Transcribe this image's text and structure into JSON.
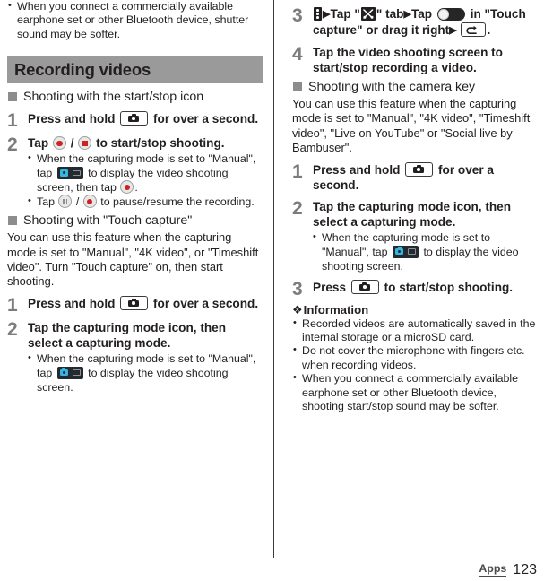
{
  "page": {
    "footer_tab": "Apps",
    "page_number": "123"
  },
  "left_column": {
    "intro_notes": [
      "When you connect a commercially available earphone set or other Bluetooth device, shutter sound may be softer."
    ],
    "section_title": "Recording videos",
    "subsection_1": {
      "heading": "Shooting with the start/stop icon",
      "steps": [
        {
          "number": "1",
          "title_before_icon": "Press and hold",
          "title_after_icon": "for over a second.",
          "icon": "camera-key-icon"
        },
        {
          "number": "2",
          "title_part_1": "Tap",
          "title_part_2": "/",
          "title_part_3": "to start/stop shooting.",
          "icon_1": "record-button-icon",
          "icon_2": "stop-button-icon",
          "notes": [
            {
              "text_1": "When the capturing mode is set to \"Manual\", tap",
              "icon": "photo-video-mode-switch-icon",
              "text_2": "to display the video shooting screen, then tap",
              "icon_2": "record-button-icon",
              "text_3": "."
            },
            {
              "text_1": "Tap",
              "icon": "pause-button-icon",
              "text_2": "/",
              "icon_2": "record-button-icon",
              "text_3": "to pause/resume the recording."
            }
          ]
        }
      ]
    },
    "subsection_2": {
      "heading": "Shooting with \"Touch capture\"",
      "paragraph": "You can use this feature when the capturing mode is set to \"Manual\", \"4K video\", or \"Timeshift video\". Turn \"Touch capture\" on, then start shooting.",
      "steps": [
        {
          "number": "1",
          "title_before_icon": "Press and hold",
          "title_after_icon": "for over a second.",
          "icon": "camera-key-icon"
        },
        {
          "number": "2",
          "title": "Tap the capturing mode icon, then select a capturing mode.",
          "notes": [
            {
              "text_1": "When the capturing mode is set to \"Manual\", tap",
              "icon": "photo-video-mode-switch-icon",
              "text_2": "to display the video shooting screen."
            }
          ]
        }
      ]
    }
  },
  "right_column": {
    "steps_continued": [
      {
        "number": "3",
        "icon_1": "overflow-menu-icon",
        "arrow_1": "▶",
        "text_1": "Tap \"",
        "icon_2": "tools-tab-icon",
        "text_2": "\" tab",
        "arrow_2": "▶",
        "text_3": "Tap",
        "icon_3": "toggle-switch-icon",
        "text_4": "in \"Touch capture\" or drag it right",
        "arrow_3": "▶",
        "icon_4": "back-key-icon",
        "text_5": "."
      },
      {
        "number": "4",
        "title": "Tap the video shooting screen to start/stop recording a video."
      }
    ],
    "subsection_3": {
      "heading": "Shooting with the camera key",
      "paragraph": "You can use this feature when the capturing mode is set to \"Manual\", \"4K video\", \"Timeshift video\", \"Live on YouTube\" or \"Social live by Bambuser\".",
      "steps": [
        {
          "number": "1",
          "title_before_icon": "Press and hold",
          "title_after_icon": "for over a second.",
          "icon": "camera-key-icon"
        },
        {
          "number": "2",
          "title": "Tap the capturing mode icon, then select a capturing mode.",
          "notes": [
            {
              "text_1": "When the capturing mode is set to \"Manual\", tap",
              "icon": "photo-video-mode-switch-icon",
              "text_2": "to display the video shooting screen."
            }
          ]
        },
        {
          "number": "3",
          "title_before_icon": "Press",
          "title_after_icon": "to start/stop shooting.",
          "icon": "camera-key-icon"
        }
      ]
    },
    "information": {
      "heading": "Information",
      "diamond": "❖",
      "notes": [
        "Recorded videos are automatically saved in the internal storage or a microSD card.",
        "Do not cover the microphone with fingers etc. when recording videos.",
        "When you connect a commercially available earphone set or other Bluetooth device, shooting start/stop sound may be softer."
      ]
    }
  },
  "colors": {
    "banner_bg": "#9a9a9a",
    "step_number": "#7c7c7c",
    "record_red": "#cc2222",
    "mode_chip_bg": "#232a30",
    "mode_chip_accent": "#35b6e0",
    "text": "#231f20"
  }
}
